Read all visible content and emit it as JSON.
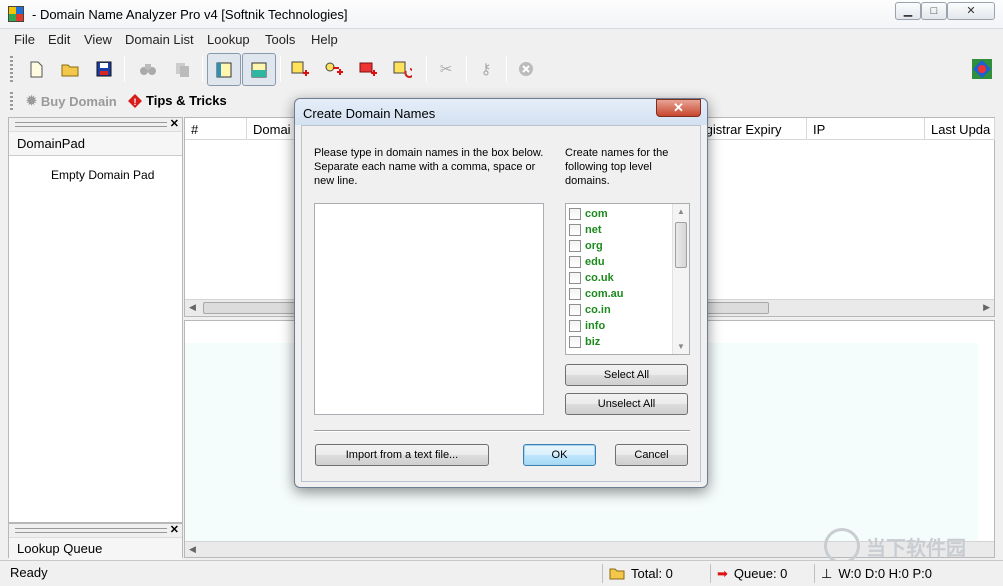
{
  "window": {
    "title": "- Domain Name Analyzer Pro v4 [Softnik Technologies]"
  },
  "menu": [
    "File",
    "Edit",
    "View",
    "Domain List",
    "Lookup",
    "Tools",
    "Help"
  ],
  "toolbar2": {
    "buy_domain": "Buy Domain",
    "tips": "Tips & Tricks"
  },
  "domainpad": {
    "title": "DomainPad",
    "empty": "Empty Domain Pad"
  },
  "lookup_queue": {
    "title": "Lookup Queue"
  },
  "list": {
    "columns": [
      "#",
      "Domai",
      "Registrar Expiry",
      "IP",
      "Last Upda"
    ]
  },
  "status": {
    "ready": "Ready",
    "total": "Total: 0",
    "queue": "Queue: 0",
    "counters": "W:0 D:0 H:0 P:0"
  },
  "dialog": {
    "title": "Create Domain Names",
    "close_label": "✕",
    "instructions": [
      "Please type in domain names in the box below.",
      "Separate each name with a comma, space or",
      "new line."
    ],
    "tld_instructions": [
      "Create names for the",
      "following  top level",
      "domains."
    ],
    "tlds": [
      "com",
      "net",
      "org",
      "edu",
      "co.uk",
      "com.au",
      "co.in",
      "info",
      "biz"
    ],
    "textbox_value": "",
    "select_all": "Select All",
    "unselect_all": "Unselect All",
    "import": "Import from a text file...",
    "ok": "OK",
    "cancel": "Cancel"
  },
  "watermark": "当下软件园",
  "colors": {
    "tld_text": "#1c8a1c",
    "close_button": "#c8452c",
    "detail_background": "#f5fcfc"
  }
}
